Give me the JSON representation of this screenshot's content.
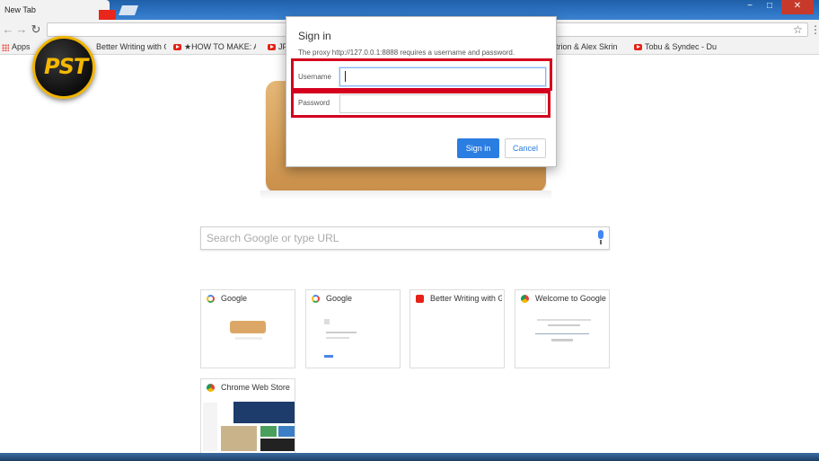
{
  "browser": {
    "tab_title": "New Tab",
    "window_controls": [
      "−",
      "□",
      "✕"
    ]
  },
  "toolbar": {
    "back_icon": "back-arrow-icon",
    "forward_icon": "forward-arrow-icon",
    "reload_icon": "reload-icon",
    "address_value": "",
    "star_icon": "bookmark-star-icon",
    "menu_icon": "menu-icon"
  },
  "bookmarks": {
    "items": [
      {
        "label": "Apps",
        "icon": "apps-icon"
      },
      {
        "label": "Better Writing with G",
        "icon": "page-icon"
      },
      {
        "label": "★HOW TO MAKE: Ac",
        "icon": "youtube-icon"
      },
      {
        "label": "JP",
        "icon": "youtube-icon"
      },
      {
        "label": "Distrion & Alex Skrin",
        "icon": "youtube-icon"
      },
      {
        "label": "Tobu & Syndec - Du",
        "icon": "youtube-icon"
      }
    ]
  },
  "logo": {
    "text": "PST"
  },
  "newtab": {
    "search_placeholder": "Search Google or type URL",
    "tiles": [
      {
        "title": "Google",
        "favicon": "google"
      },
      {
        "title": "Google",
        "favicon": "google"
      },
      {
        "title": "Better Writing with Gr",
        "favicon": "youtube"
      },
      {
        "title": "Welcome to Google C",
        "favicon": "chrome"
      },
      {
        "title": "Chrome Web Store",
        "favicon": "chrome"
      }
    ]
  },
  "dialog": {
    "title": "Sign in",
    "message": "The proxy http://127.0.0.1:8888 requires a username and password.",
    "username_label": "Username",
    "username_value": "",
    "password_label": "Password",
    "password_value": "",
    "signin_label": "Sign in",
    "cancel_label": "Cancel"
  },
  "colors": {
    "highlight": "#d4001e",
    "primary_button": "#2a7de1",
    "titlebar": "#2e74c4"
  }
}
